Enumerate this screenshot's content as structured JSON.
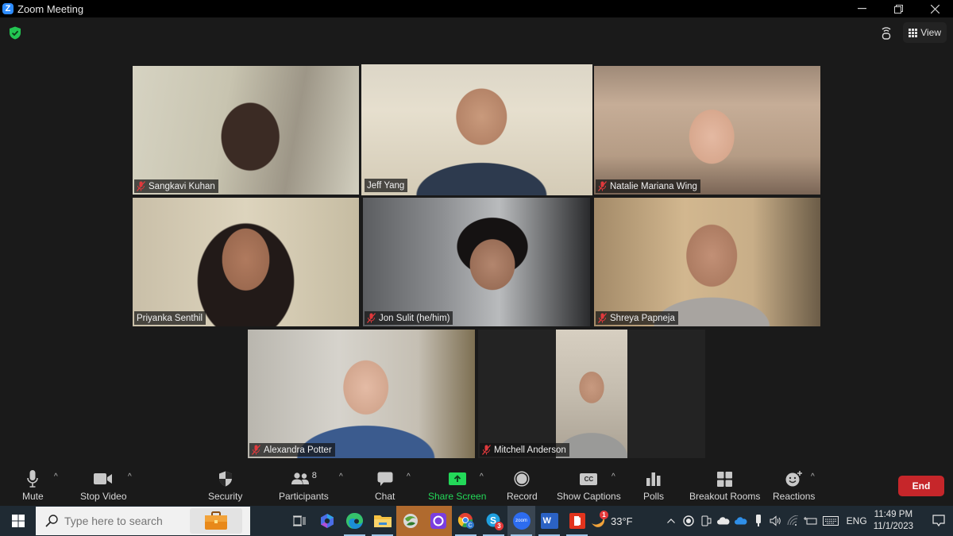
{
  "window": {
    "app_name": "Zoom Meeting",
    "logo_letter": "Z",
    "controls": [
      "minimize",
      "restore",
      "close"
    ]
  },
  "meeting": {
    "encryption_icon": "shield-check-icon",
    "view_label": "View",
    "active_speaker_color": "#b6dc5b",
    "participants": [
      {
        "name": "Sangkavi Kuhan",
        "muted": true
      },
      {
        "name": "Jeff Yang",
        "muted": false,
        "active_speaker": true
      },
      {
        "name": "Natalie Mariana Wing",
        "muted": true
      },
      {
        "name": "Priyanka Senthil",
        "muted": false
      },
      {
        "name": "Jon Sulit (he/him)",
        "muted": true
      },
      {
        "name": "Shreya Papneja",
        "muted": true
      },
      {
        "name": "Alexandra Potter",
        "muted": true
      },
      {
        "name": "Mitchell Anderson",
        "muted": true
      }
    ]
  },
  "toolbar": {
    "mute": "Mute",
    "stop_video": "Stop Video",
    "security": "Security",
    "participants": "Participants",
    "participants_count": "8",
    "chat": "Chat",
    "share_screen": "Share Screen",
    "record": "Record",
    "show_captions": "Show Captions",
    "captions_glyph": "CC",
    "polls": "Polls",
    "breakout_rooms": "Breakout Rooms",
    "reactions": "Reactions",
    "end": "End",
    "share_color": "#23d959",
    "end_color": "#c6262a"
  },
  "taskbar": {
    "search_placeholder": "Type here to search",
    "apps": [
      "task-view",
      "copilot",
      "edge",
      "file-explorer",
      "app-green",
      "app-purple",
      "chrome",
      "skype",
      "zoom",
      "word",
      "acrobat"
    ],
    "skype_badge": "3",
    "zoom_app_label": "zoom",
    "word_glyph": "W",
    "weather_badge": "1",
    "temperature": "33°F",
    "language": "ENG",
    "time": "11:49 PM",
    "date": "11/1/2023"
  }
}
